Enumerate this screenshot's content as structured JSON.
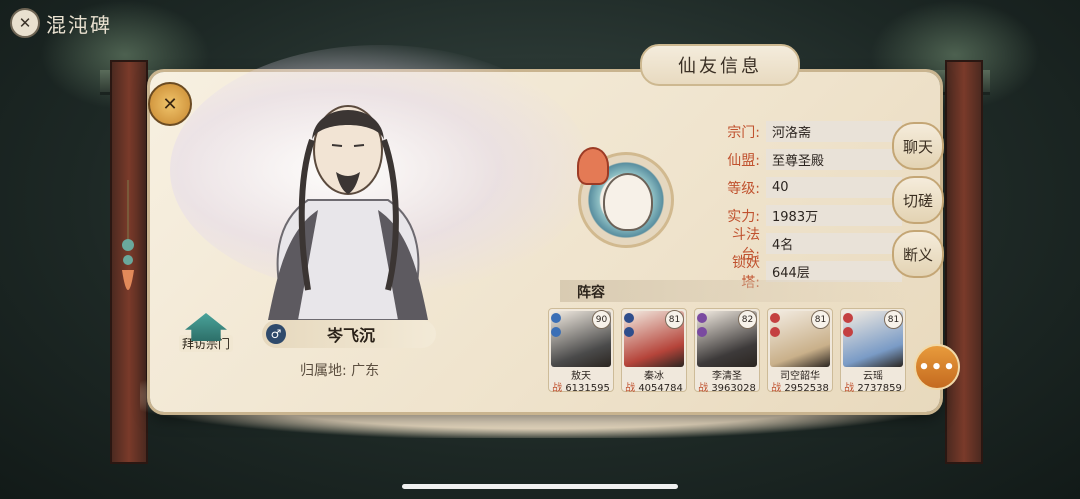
{
  "top": {
    "close_icon": "close-icon",
    "title": "混沌碑"
  },
  "header": {
    "title": "仙友信息"
  },
  "player": {
    "name": "岑飞沉",
    "region_label": "归属地:",
    "region": "广东",
    "visit_label": "拜访宗门",
    "medal_glyph": "✕"
  },
  "info": [
    {
      "label": "宗门:",
      "value": "河洛斋"
    },
    {
      "label": "仙盟:",
      "value": "至尊圣殿"
    },
    {
      "label": "等级:",
      "value": "40"
    },
    {
      "label": "实力:",
      "value": "1983万"
    },
    {
      "label": "斗法台:",
      "value": "4名"
    },
    {
      "label": "锁妖塔:",
      "value": "644层"
    }
  ],
  "actions": {
    "chat": "聊天",
    "spar": "切磋",
    "break": "断义"
  },
  "lineup": {
    "label": "阵容",
    "power_prefix": "战",
    "heroes": [
      {
        "name": "敖天",
        "level": "90",
        "power": "6131595",
        "color": "#4a4a4a",
        "element": "#3b6fb6"
      },
      {
        "name": "秦冰",
        "level": "81",
        "power": "4054784",
        "color": "#b5443a",
        "element": "#2f4e8c"
      },
      {
        "name": "李清圣",
        "level": "82",
        "power": "3963028",
        "color": "#3d3a3a",
        "element": "#7a4aa0"
      },
      {
        "name": "司空韶华",
        "level": "81",
        "power": "2952538",
        "color": "#c9b08a",
        "element": "#c44040"
      },
      {
        "name": "云瑶",
        "level": "81",
        "power": "2737859",
        "color": "#7a9bc6",
        "element": "#c44040"
      }
    ]
  },
  "more_label": "•••",
  "colors": {
    "accent": "#c0522f",
    "card": "#f3ead8",
    "more": "#d67a2a"
  }
}
